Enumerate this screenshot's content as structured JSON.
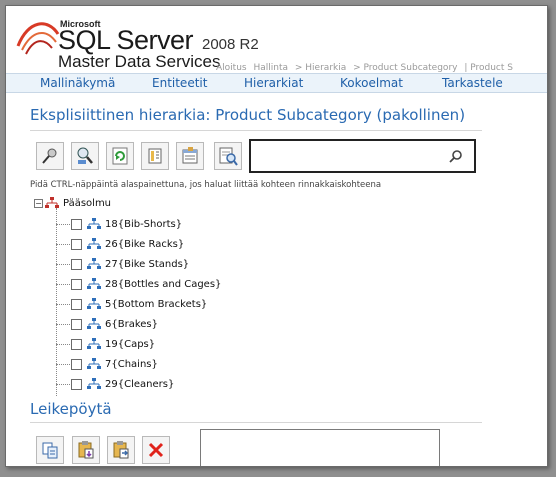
{
  "header": {
    "brand_small": "Microsoft",
    "brand_product": "SQL Server",
    "brand_version": "2008 R2",
    "brand_subtitle": "Master Data Services",
    "breadcrumb": [
      "Aloitus",
      "Hallinta",
      "> Hierarkia",
      "> Product Subcategory",
      "| Product S"
    ]
  },
  "menu": [
    "Mallinäkymä",
    "Entiteetit",
    "Hierarkiat",
    "Kokoelmat",
    "Tarkastele"
  ],
  "page_title": "Eksplisiittinen hierarkia: Product Subcategory (pakollinen)",
  "toolbar": {
    "icons": [
      "pin-icon",
      "find-member-icon",
      "refresh-icon",
      "view-icon",
      "properties-icon",
      "search-preview-icon"
    ]
  },
  "search": {
    "value": "",
    "placeholder": ""
  },
  "hint": "Pidä CTRL-näppäintä alaspainettuna, jos haluat liittää kohteen rinnakkaiskohteena",
  "tree": {
    "root_expander": "−",
    "root_label": "Pääsolmu",
    "nodes": [
      "18{Bib-Shorts}",
      "26{Bike Racks}",
      "27{Bike Stands}",
      "28{Bottles and Cages}",
      "5{Bottom Brackets}",
      "6{Brakes}",
      "19{Caps}",
      "7{Chains}",
      "29{Cleaners}"
    ]
  },
  "clipboard": {
    "title": "Leikepöytä",
    "icons": [
      "copy-icon",
      "paste-child-icon",
      "paste-sibling-icon",
      "delete-icon"
    ]
  },
  "colors": {
    "accent": "#2a6ab2",
    "menu_bg": "#ebf3fa",
    "delete": "#e0231b"
  }
}
